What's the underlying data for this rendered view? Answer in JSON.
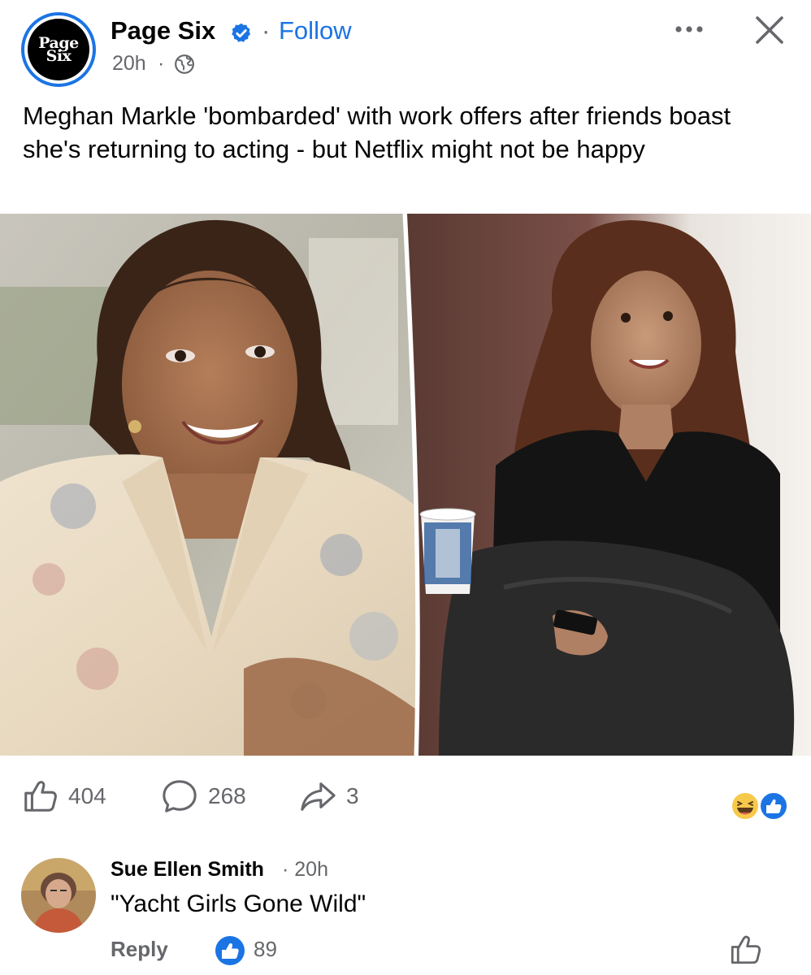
{
  "post": {
    "page_name": "Page Six",
    "avatar_text_top": "Page",
    "avatar_text_bottom": "Six",
    "separator": "·",
    "follow_label": "Follow",
    "time": "20h",
    "time_separator": "·",
    "caption": "Meghan Markle 'bombarded' with work offers after friends boast she's returning to acting - but Netflix might not be happy",
    "colors": {
      "accent": "#1b74e4",
      "muted": "#65676b",
      "text": "#050505"
    }
  },
  "actions": {
    "likes": "404",
    "comments": "268",
    "shares": "3"
  },
  "icons": {
    "verified": "verified-badge-icon",
    "globe": "globe-icon",
    "more": "more-options-icon",
    "close": "close-icon",
    "like": "thumbs-up-icon",
    "comment": "comment-bubble-icon",
    "share": "share-arrow-icon",
    "reactions": [
      "haha-emoji-icon",
      "like-reaction-icon"
    ]
  },
  "comment": {
    "author": "Sue Ellen Smith",
    "time": "· 20h",
    "text": "\"Yacht Girls Gone Wild\"",
    "reply_label": "Reply",
    "like_count": "89"
  }
}
